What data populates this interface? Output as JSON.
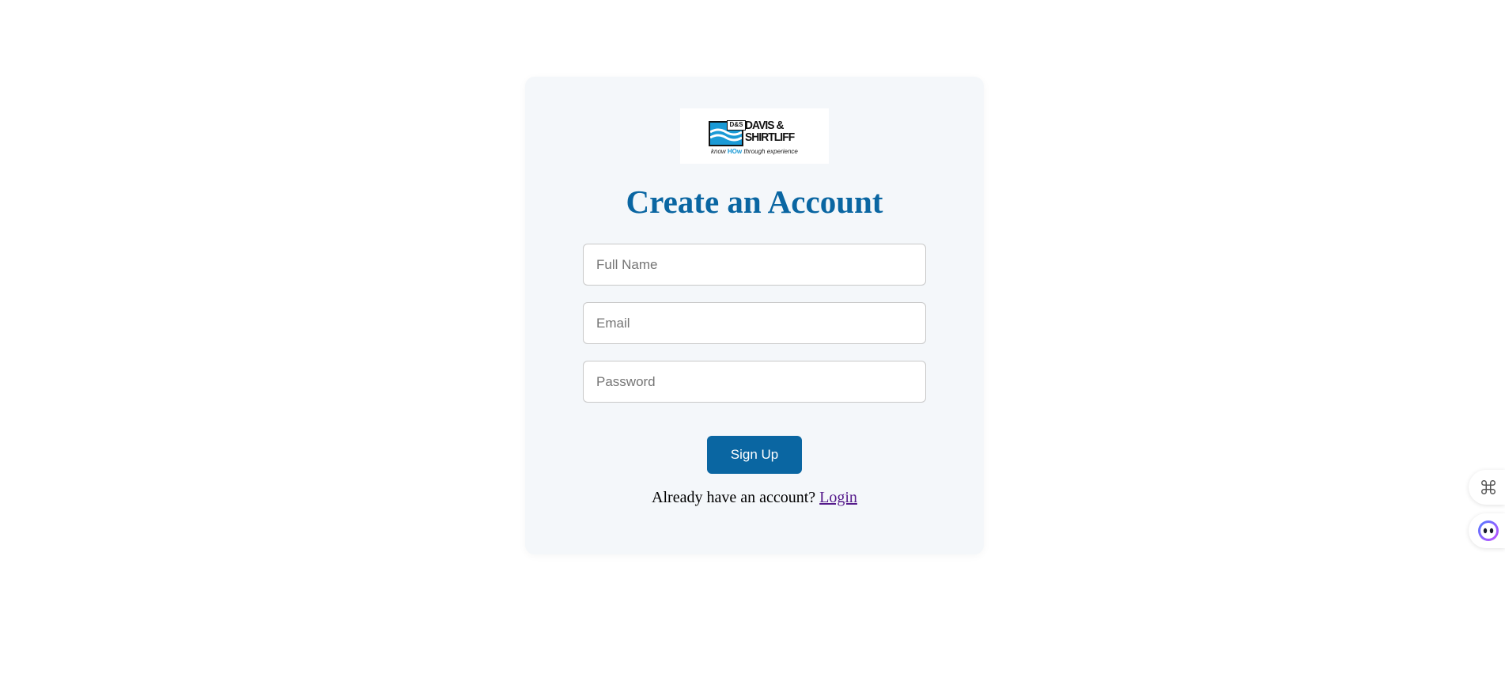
{
  "logo": {
    "badge": "D&S",
    "name_line1": "DAVIS &",
    "name_line2": "SHIRTLIFF",
    "tagline_prefix": "know ",
    "tagline_highlight": "HOw",
    "tagline_suffix": " through experience"
  },
  "form": {
    "title": "Create an Account",
    "full_name_placeholder": "Full Name",
    "full_name_value": "",
    "email_placeholder": "Email",
    "email_value": "",
    "password_placeholder": "Password",
    "password_value": "",
    "submit_label": "Sign Up",
    "login_prompt": "Already have an account? ",
    "login_link": "Login"
  },
  "floating_widgets": [
    {
      "icon": "command-icon"
    },
    {
      "icon": "assistant-face-icon"
    }
  ],
  "colors": {
    "brand_blue": "#0a66a2",
    "card_bg": "#f4f7fa",
    "link_visited": "#551a8b"
  }
}
